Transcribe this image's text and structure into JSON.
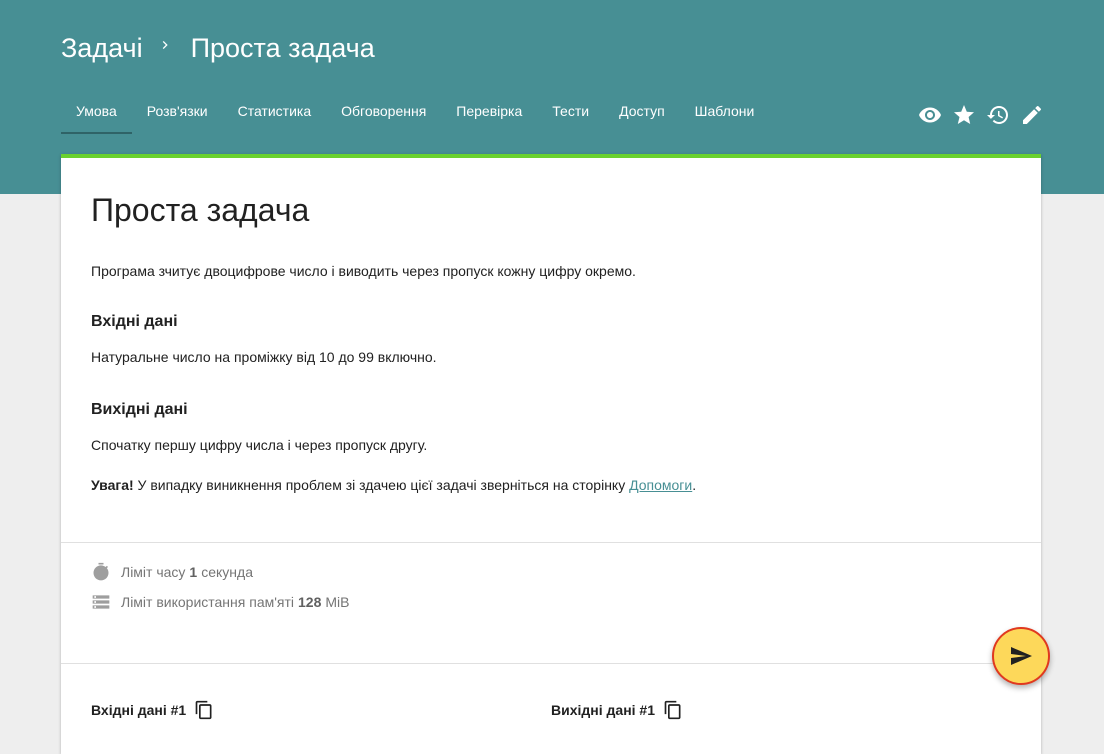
{
  "breadcrumb": {
    "root": "Задачі",
    "current": "Проста задача"
  },
  "tabs": [
    {
      "label": "Умова"
    },
    {
      "label": "Розв'язки"
    },
    {
      "label": "Статистика"
    },
    {
      "label": "Обговорення"
    },
    {
      "label": "Перевірка"
    },
    {
      "label": "Тести"
    },
    {
      "label": "Доступ"
    },
    {
      "label": "Шаблони"
    }
  ],
  "toolbar": {
    "icons": [
      "eye-icon",
      "star-icon",
      "history-icon",
      "edit-icon"
    ]
  },
  "problem": {
    "title": "Проста задача",
    "description": "Програма зчитує двоцифрове число і виводить через пропуск кожну цифру окремо.",
    "input_heading": "Вхідні дані",
    "input_text": "Натуральне число на проміжку від 10 до 99 включно.",
    "output_heading": "Вихідні дані",
    "output_text": "Спочатку першу цифру числа і через пропуск другу.",
    "warning_bold": "Увага!",
    "warning_text": " У випадку виникнення проблем зі здачею цієї задачі зверніться на сторінку ",
    "warning_link": "Допомоги",
    "warning_end": "."
  },
  "limits": {
    "time_label": "Ліміт часу",
    "time_value": "1",
    "time_unit": "секунда",
    "memory_label": "Ліміт використання пам'яті",
    "memory_value": "128",
    "memory_unit": "MiB"
  },
  "samples": {
    "input_label": "Вхідні дані #1",
    "output_label": "Вихідні дані #1"
  },
  "colors": {
    "header": "#478f94",
    "accent_bar": "#6ad12f",
    "fab_fill": "#fdd85a",
    "fab_border": "#e0391f"
  }
}
